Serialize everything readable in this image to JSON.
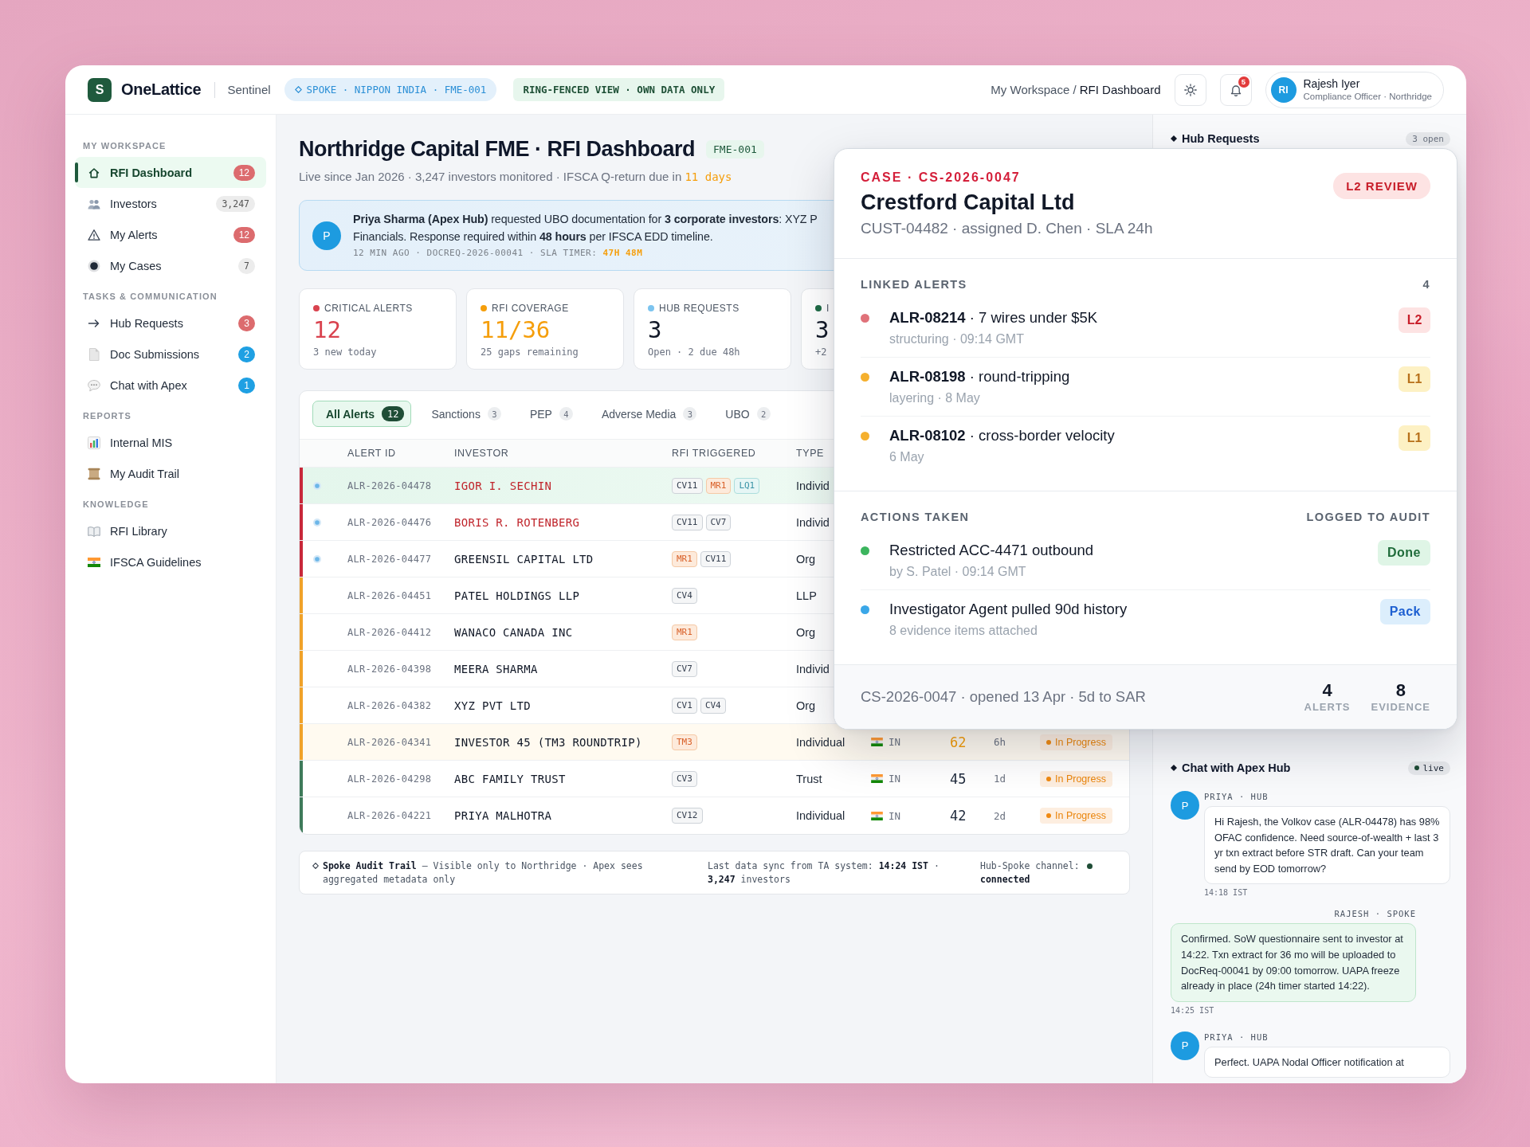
{
  "header": {
    "logo_letter": "S",
    "brand": "OneLattice",
    "product": "Sentinel",
    "scope_tag": "SPOKE · NIPPON INDIA · FME-001",
    "view_tag": "RING-FENCED VIEW · OWN DATA ONLY",
    "breadcrumb": {
      "parent": "My Workspace",
      "separator": "/",
      "current": "RFI Dashboard"
    },
    "notification_count": "5",
    "user": {
      "initials": "RI",
      "name": "Rajesh Iyer",
      "role": "Compliance Officer · Northridge"
    }
  },
  "sidebar": {
    "sections": [
      {
        "title": "MY WORKSPACE",
        "items": [
          {
            "label": "RFI Dashboard",
            "badge": {
              "text": "12",
              "kind": "alert"
            },
            "selected": true
          },
          {
            "label": "Investors",
            "badge": {
              "text": "3,247",
              "kind": "count"
            },
            "selected": false
          },
          {
            "label": "My Alerts",
            "badge": {
              "text": "12",
              "kind": "alert"
            },
            "selected": false
          },
          {
            "label": "My Cases",
            "badge": {
              "text": "7",
              "kind": "count"
            },
            "selected": false
          }
        ]
      },
      {
        "title": "TASKS & COMMUNICATION",
        "items": [
          {
            "label": "Hub Requests",
            "badge": {
              "text": "3",
              "kind": "alert"
            },
            "selected": false
          },
          {
            "label": "Doc Submissions",
            "badge": {
              "text": "2",
              "kind": "info"
            },
            "selected": false
          },
          {
            "label": "Chat with Apex",
            "badge": {
              "text": "1",
              "kind": "info"
            },
            "selected": false
          }
        ]
      },
      {
        "title": "REPORTS",
        "items": [
          {
            "label": "Internal MIS",
            "selected": false
          },
          {
            "label": "My Audit Trail",
            "selected": false
          }
        ]
      },
      {
        "title": "KNOWLEDGE",
        "items": [
          {
            "label": "RFI Library",
            "selected": false
          },
          {
            "label": "IFSCA Guidelines",
            "selected": false
          }
        ]
      }
    ]
  },
  "page": {
    "title": "Northridge Capital FME · RFI Dashboard",
    "code": "FME-001",
    "subtitle": {
      "text": "Live since Jan 2026 · 3,247 investors monitored · IFSCA Q-return due in",
      "due": "11 days"
    },
    "request": {
      "avatar": "P",
      "message": [
        "**Priya Sharma (Apex Hub)** requested UBO documentation for **3 corporate investors**: XYZ P",
        "Financials. Response required within **48 hours** per IFSCA EDD timeline."
      ],
      "meta": "12 MIN AGO · DOCREQ-2026-00041 · SLA TIMER:",
      "timer": "47H 48M"
    }
  },
  "stats": [
    {
      "label": "CRITICAL ALERTS",
      "value": "12",
      "note": "3 new today",
      "color": "#d9434f",
      "accent": true
    },
    {
      "label": "RFI COVERAGE",
      "value": "11/36",
      "note": "25 gaps remaining",
      "color": "#f59e0b",
      "accent": true
    },
    {
      "label": "HUB REQUESTS",
      "value": "3",
      "note": "Open · 2 due 48h",
      "color": "#7cc4ef",
      "accent": false
    },
    {
      "label": "I",
      "value": "3",
      "note": "+2",
      "color": "#1f6b45",
      "accent": false
    }
  ],
  "alerts": {
    "tabs": [
      {
        "label": "All Alerts",
        "count": "12",
        "selected": true
      },
      {
        "label": "Sanctions",
        "count": "3",
        "selected": false
      },
      {
        "label": "PEP",
        "count": "4",
        "selected": false
      },
      {
        "label": "Adverse Media",
        "count": "3",
        "selected": false
      },
      {
        "label": "UBO",
        "count": "2",
        "selected": false
      }
    ],
    "columns": [
      "ALERT ID",
      "INVESTOR",
      "RFI TRIGGERED",
      "TYPE"
    ],
    "rows": [
      {
        "alert_id": "ALR-2026-04478",
        "investor": "IGOR I. SECHIN",
        "rfi": [
          {
            "code": "CV11",
            "kind": "neutral"
          },
          {
            "code": "MR1",
            "kind": "warn"
          },
          {
            "code": "LQ1",
            "kind": "info"
          }
        ],
        "type": "Individ",
        "color": "#c8283a",
        "flagged": true,
        "sanctioned": true,
        "selected": true,
        "highlighted": false
      },
      {
        "alert_id": "ALR-2026-04476",
        "investor": "BORIS R. ROTENBERG",
        "rfi": [
          {
            "code": "CV11",
            "kind": "neutral"
          },
          {
            "code": "CV7",
            "kind": "neutral"
          }
        ],
        "type": "Individ",
        "color": "#c8283a",
        "flagged": true,
        "sanctioned": true,
        "selected": false,
        "highlighted": false
      },
      {
        "alert_id": "ALR-2026-04477",
        "investor": "GREENSIL CAPITAL LTD",
        "rfi": [
          {
            "code": "MR1",
            "kind": "warn"
          },
          {
            "code": "CV11",
            "kind": "neutral"
          }
        ],
        "type": "Org",
        "color": "#c8283a",
        "flagged": true,
        "sanctioned": false,
        "selected": false,
        "highlighted": false
      },
      {
        "alert_id": "ALR-2026-04451",
        "investor": "PATEL HOLDINGS LLP",
        "rfi": [
          {
            "code": "CV4",
            "kind": "neutral"
          }
        ],
        "type": "LLP",
        "color": "#f0a229",
        "flagged": false,
        "sanctioned": false,
        "selected": false,
        "highlighted": false
      },
      {
        "alert_id": "ALR-2026-04412",
        "investor": "WANACO CANADA INC",
        "rfi": [
          {
            "code": "MR1",
            "kind": "warn"
          }
        ],
        "type": "Org",
        "color": "#f0a229",
        "flagged": false,
        "sanctioned": false,
        "selected": false,
        "highlighted": false
      },
      {
        "alert_id": "ALR-2026-04398",
        "investor": "MEERA SHARMA",
        "rfi": [
          {
            "code": "CV7",
            "kind": "neutral"
          }
        ],
        "type": "Individ",
        "color": "#f0a229",
        "flagged": false,
        "sanctioned": false,
        "selected": false,
        "highlighted": false
      },
      {
        "alert_id": "ALR-2026-04382",
        "investor": "XYZ PVT LTD",
        "rfi": [
          {
            "code": "CV1",
            "kind": "neutral"
          },
          {
            "code": "CV4",
            "kind": "neutral"
          }
        ],
        "type": "Org",
        "color": "#f0a229",
        "flagged": false,
        "sanctioned": false,
        "selected": false,
        "highlighted": false
      },
      {
        "alert_id": "ALR-2026-04341",
        "investor": "INVESTOR 45 (TM3 ROUNDTRIP)",
        "rfi": [
          {
            "code": "TM3",
            "kind": "warn"
          }
        ],
        "type": "Individual",
        "country": "IN",
        "score": "62",
        "score_elevated": true,
        "age": "6h",
        "status": "In Progress",
        "color": "#f0a229",
        "flagged": false,
        "sanctioned": false,
        "selected": false,
        "highlighted": true
      },
      {
        "alert_id": "ALR-2026-04298",
        "investor": "ABC FAMILY TRUST",
        "rfi": [
          {
            "code": "CV3",
            "kind": "neutral"
          }
        ],
        "type": "Trust",
        "country": "IN",
        "score": "45",
        "score_elevated": false,
        "age": "1d",
        "status": "In Progress",
        "color": "#3e7a5a",
        "flagged": false,
        "sanctioned": false,
        "selected": false,
        "highlighted": false
      },
      {
        "alert_id": "ALR-2026-04221",
        "investor": "PRIYA MALHOTRA",
        "rfi": [
          {
            "code": "CV12",
            "kind": "neutral"
          }
        ],
        "type": "Individual",
        "country": "IN",
        "score": "42",
        "score_elevated": false,
        "age": "2d",
        "status": "In Progress",
        "color": "#3e7a5a",
        "flagged": false,
        "sanctioned": false,
        "selected": false,
        "highlighted": false
      }
    ]
  },
  "footer": {
    "audit": "**Spoke Audit Trail** — Visible only to Northridge · Apex sees aggregated metadata only",
    "sync": "Last data sync from TA system: **14:24 IST** · **3,247** investors",
    "channel_label": "Hub-Spoke channel:",
    "channel_state": "connected"
  },
  "right_panel": {
    "hub_requests": {
      "title": "Hub Requests",
      "count": "3 open"
    },
    "chat": {
      "title": "Chat with Apex Hub",
      "status": "live",
      "messages": [
        {
          "kind": "hub",
          "avatar": "P",
          "author": "PRIYA · HUB",
          "text": "Hi Rajesh, the Volkov case (ALR-04478) has 98% OFAC confidence. Need source-of-wealth + last 3 yr txn extract before STR draft. Can your team send by EOD tomorrow?",
          "time": "14:18 IST"
        },
        {
          "kind": "spoke",
          "author": "RAJESH · SPOKE",
          "text": "Confirmed. SoW questionnaire sent to investor at 14:22. Txn extract for 36 mo will be uploaded to DocReq-00041 by 09:00 tomorrow. UAPA freeze already in place (24h timer started 14:22).",
          "time": "14:25 IST"
        },
        {
          "kind": "hub",
          "avatar": "P",
          "author": "PRIYA · HUB",
          "text": "Perfect. UAPA Nodal Officer notification at"
        }
      ]
    }
  },
  "case_panel": {
    "case_id": "CASE · CS-2026-0047",
    "review": "L2 REVIEW",
    "title": "Crestford Capital Ltd",
    "meta": "CUST-04482 · assigned D. Chen · SLA 24h",
    "linked": {
      "title": "LINKED ALERTS",
      "count": "4",
      "alerts": [
        {
          "title": "**ALR-08214** · 7 wires under $5K",
          "detail": "structuring · 09:14 GMT",
          "level": "L2",
          "kind": "high",
          "color": "#e0727a"
        },
        {
          "title": "**ALR-08198** · round-tripping",
          "detail": "layering · 8 May",
          "level": "L1",
          "kind": "medium",
          "color": "#f5b02e"
        },
        {
          "title": "**ALR-08102** · cross-border velocity",
          "detail": "6 May",
          "level": "L1",
          "kind": "medium",
          "color": "#f5b02e"
        }
      ]
    },
    "actions": {
      "title": "ACTIONS TAKEN",
      "note": "LOGGED TO AUDIT",
      "items": [
        {
          "title": "Restricted ACC-4471 outbound",
          "detail": "by S. Patel · 09:14 GMT",
          "tag": "Done",
          "kind": "done",
          "color": "#3cb55e"
        },
        {
          "title": "Investigator Agent pulled 90d history",
          "detail": "8 evidence items attached",
          "tag": "Pack",
          "kind": "pack",
          "color": "#3aa7e8"
        }
      ]
    },
    "footer": {
      "summary": "CS-2026-0047 · opened 13 Apr · 5d to SAR",
      "stats": [
        {
          "value": "4",
          "label": "ALERTS"
        },
        {
          "value": "8",
          "label": "EVIDENCE"
        }
      ]
    }
  }
}
